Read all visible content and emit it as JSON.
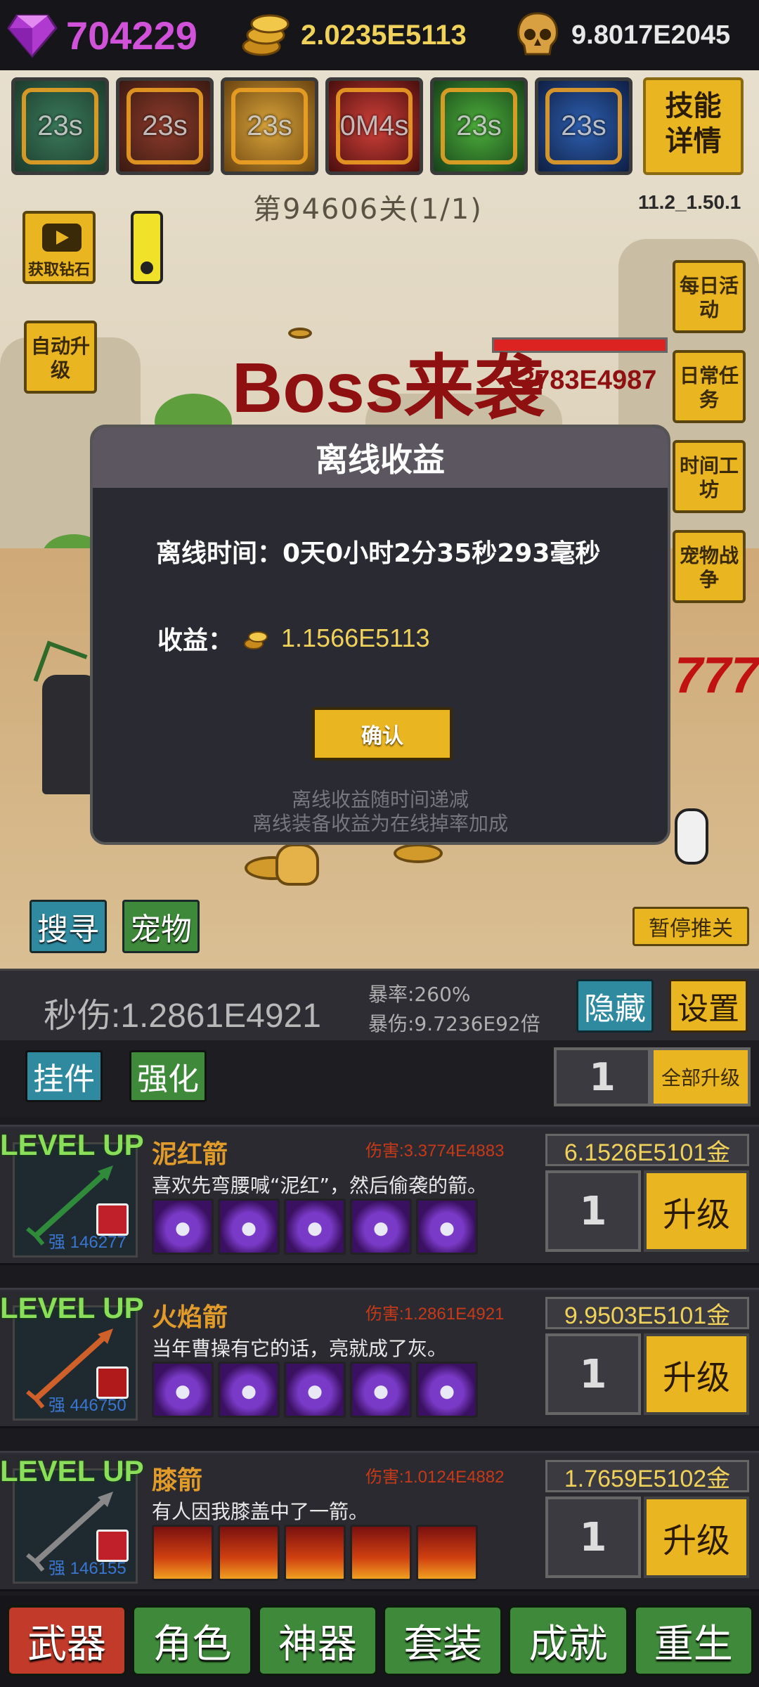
{
  "resources": {
    "diamonds": "704229",
    "gold": "2.0235E5113",
    "skulls": "9.8017E2045"
  },
  "skills": [
    {
      "icon": "skill-1-icon",
      "cooldown": "23s"
    },
    {
      "icon": "skill-2-icon",
      "cooldown": "23s"
    },
    {
      "icon": "skill-3-icon",
      "cooldown": "23s"
    },
    {
      "icon": "skill-4-icon",
      "cooldown": "0M4s"
    },
    {
      "icon": "skill-5-icon",
      "cooldown": "23s"
    },
    {
      "icon": "skill-6-icon",
      "cooldown": "23s"
    }
  ],
  "skill_detail_label": "技能详情",
  "stage": {
    "title": "第94606关(1/1)",
    "version": "11.2_1.50.1"
  },
  "left_buttons": {
    "get_diamonds": "获取钻石",
    "auto_upgrade": "自动升级"
  },
  "right_buttons": [
    "每日活动",
    "日常任务",
    "时间工坊",
    "宠物战争"
  ],
  "boss": {
    "banner": "Boss来袭",
    "hp": "3783E4987"
  },
  "battle_buttons": {
    "search": "搜寻",
    "pet": "宠物",
    "pause": "暂停推关"
  },
  "modal": {
    "title": "离线收益",
    "time_label": "离线时间：",
    "time_value": "0天0小时2分35秒293毫秒",
    "income_label": "收益：",
    "income_value": "1.1566E5113",
    "confirm": "确认",
    "note1": "离线收益随时间递减",
    "note2": "离线装备收益为在线掉率加成"
  },
  "stats": {
    "dps": "秒伤:1.2861E4921",
    "crit_rate": "暴率:260%",
    "crit_damage": "暴伤:9.7236E92倍",
    "hide": "隐藏",
    "settings": "设置"
  },
  "upgrade_header": {
    "tab_pendant": "挂件",
    "tab_enhance": "强化",
    "quantity": "1",
    "upgrade_all": "全部升级"
  },
  "weapons": [
    {
      "level_up": "LEVEL UP",
      "name": "泥红箭",
      "damage": "伤害:3.3774E4883",
      "description": "喜欢先弯腰喊“泥红”，然后偷袭的箭。",
      "enhance": "强 146277",
      "price": "6.1526E5101金",
      "quantity": "1",
      "upgrade": "升级",
      "color": "#2f8a3a"
    },
    {
      "level_up": "LEVEL UP",
      "name": "火焰箭",
      "damage": "伤害:1.2861E4921",
      "description": "当年曹操有它的话，亮就成了灰。",
      "enhance": "强 446750",
      "price": "9.9503E5101金",
      "quantity": "1",
      "upgrade": "升级",
      "color": "#d0602a"
    },
    {
      "level_up": "LEVEL UP",
      "name": "膝箭",
      "damage": "伤害:1.0124E4882",
      "description": "有人因我膝盖中了一箭。",
      "enhance": "强 146155",
      "price": "1.7659E5102金",
      "quantity": "1",
      "upgrade": "升级",
      "color": "#888888"
    }
  ],
  "bottom_nav": [
    {
      "label": "武器",
      "active": true
    },
    {
      "label": "角色",
      "active": false
    },
    {
      "label": "神器",
      "active": false
    },
    {
      "label": "套装",
      "active": false
    },
    {
      "label": "成就",
      "active": false
    },
    {
      "label": "重生",
      "active": false
    }
  ]
}
